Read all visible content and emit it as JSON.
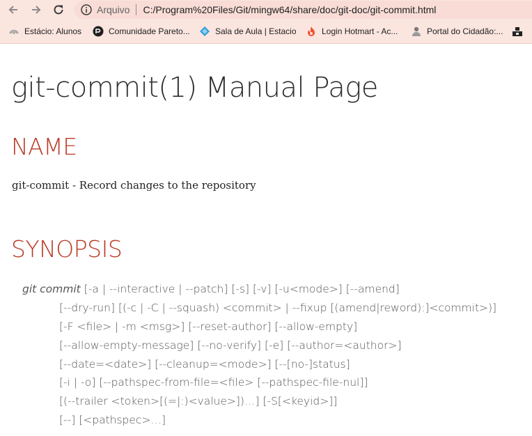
{
  "browser": {
    "omnibox": {
      "security_label": "Arquivo",
      "url": "C:/Program%20Files/Git/mingw64/share/doc/git-doc/git-commit.html"
    },
    "bookmarks": [
      {
        "label": "Estácio: Alunos",
        "icon": "estacio-icon"
      },
      {
        "label": "Comunidade Pareto...",
        "icon": "pareto-icon"
      },
      {
        "label": "Sala de Aula | Estacio",
        "icon": "diamond-icon"
      },
      {
        "label": "Login Hotmart - Ac...",
        "icon": "flame-icon"
      },
      {
        "label": "Portal do Cidadão:...",
        "icon": "portal-icon"
      }
    ],
    "colors": {
      "chrome_bg": "#fbe5df",
      "omnibox_bg": "#f8dcd5"
    }
  },
  "page": {
    "title": "git-commit(1) Manual Page",
    "sections": {
      "name": {
        "heading": "NAME",
        "text": "git-commit - Record changes to the repository"
      },
      "synopsis": {
        "heading": "SYNOPSIS",
        "command": "git commit",
        "first_line": " [-a | --interactive | --patch] [-s] [-v] [-u<mode>] [--amend]",
        "lines": [
          "[--dry-run] [(-c | -C | --squash) <commit> | --fixup [(amend|reword):]<commit>)]",
          "[-F <file> | -m <msg>] [--reset-author] [--allow-empty]",
          "[--allow-empty-message] [--no-verify] [-e] [--author=<author>]",
          "[--date=<date>] [--cleanup=<mode>] [--[no-]status]",
          "[-i | -o] [--pathspec-from-file=<file> [--pathspec-file-nul]]",
          "[(--trailer <token>[(=|:)<value>])…] [-S[<keyid>]]",
          "[--] [<pathspec>…]"
        ]
      }
    },
    "colors": {
      "heading": "#ba3925",
      "title": "#2e2e2e",
      "synopsis_text": "#555555"
    }
  }
}
